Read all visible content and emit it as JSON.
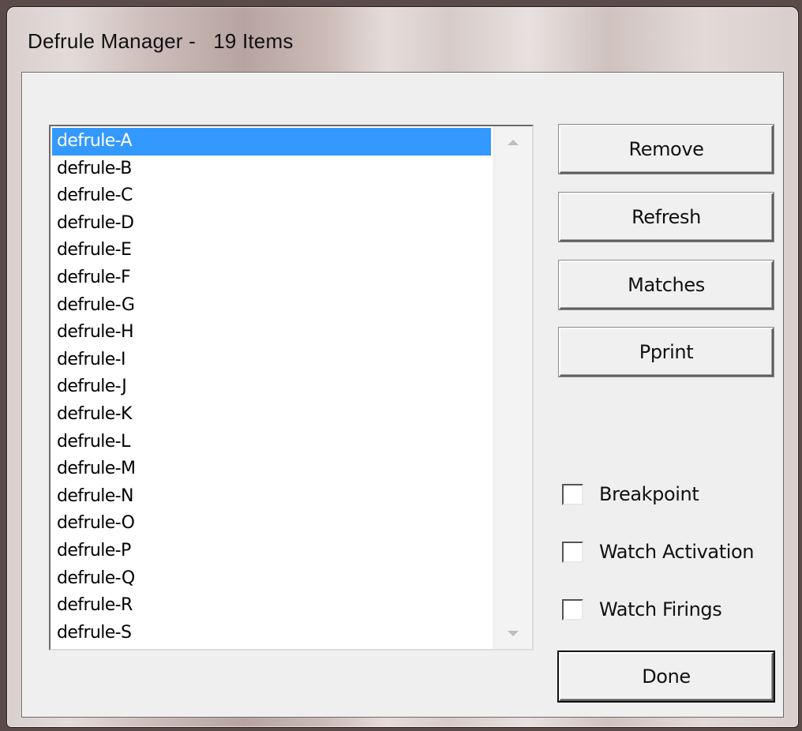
{
  "window": {
    "title": "Defrule Manager -   19 Items"
  },
  "list": {
    "items": [
      {
        "label": "defrule-A",
        "selected": true
      },
      {
        "label": "defrule-B"
      },
      {
        "label": "defrule-C"
      },
      {
        "label": "defrule-D"
      },
      {
        "label": "defrule-E"
      },
      {
        "label": "defrule-F"
      },
      {
        "label": "defrule-G"
      },
      {
        "label": "defrule-H"
      },
      {
        "label": "defrule-I"
      },
      {
        "label": "defrule-J"
      },
      {
        "label": "defrule-K"
      },
      {
        "label": "defrule-L"
      },
      {
        "label": "defrule-M"
      },
      {
        "label": "defrule-N"
      },
      {
        "label": "defrule-O"
      },
      {
        "label": "defrule-P"
      },
      {
        "label": "defrule-Q"
      },
      {
        "label": "defrule-R"
      },
      {
        "label": "defrule-S"
      }
    ]
  },
  "buttons": {
    "remove": "Remove",
    "refresh": "Refresh",
    "matches": "Matches",
    "pprint": "Pprint",
    "done": "Done"
  },
  "checkboxes": {
    "breakpoint": {
      "label": "Breakpoint",
      "checked": false
    },
    "watch_activation": {
      "label": "Watch Activation",
      "checked": false
    },
    "watch_firings": {
      "label": "Watch Firings",
      "checked": false
    }
  },
  "colors": {
    "selection": "#3399ff",
    "client_bg": "#efefef"
  },
  "icons": {
    "scroll_up": "scroll-up-arrow-icon",
    "scroll_down": "scroll-down-arrow-icon"
  }
}
